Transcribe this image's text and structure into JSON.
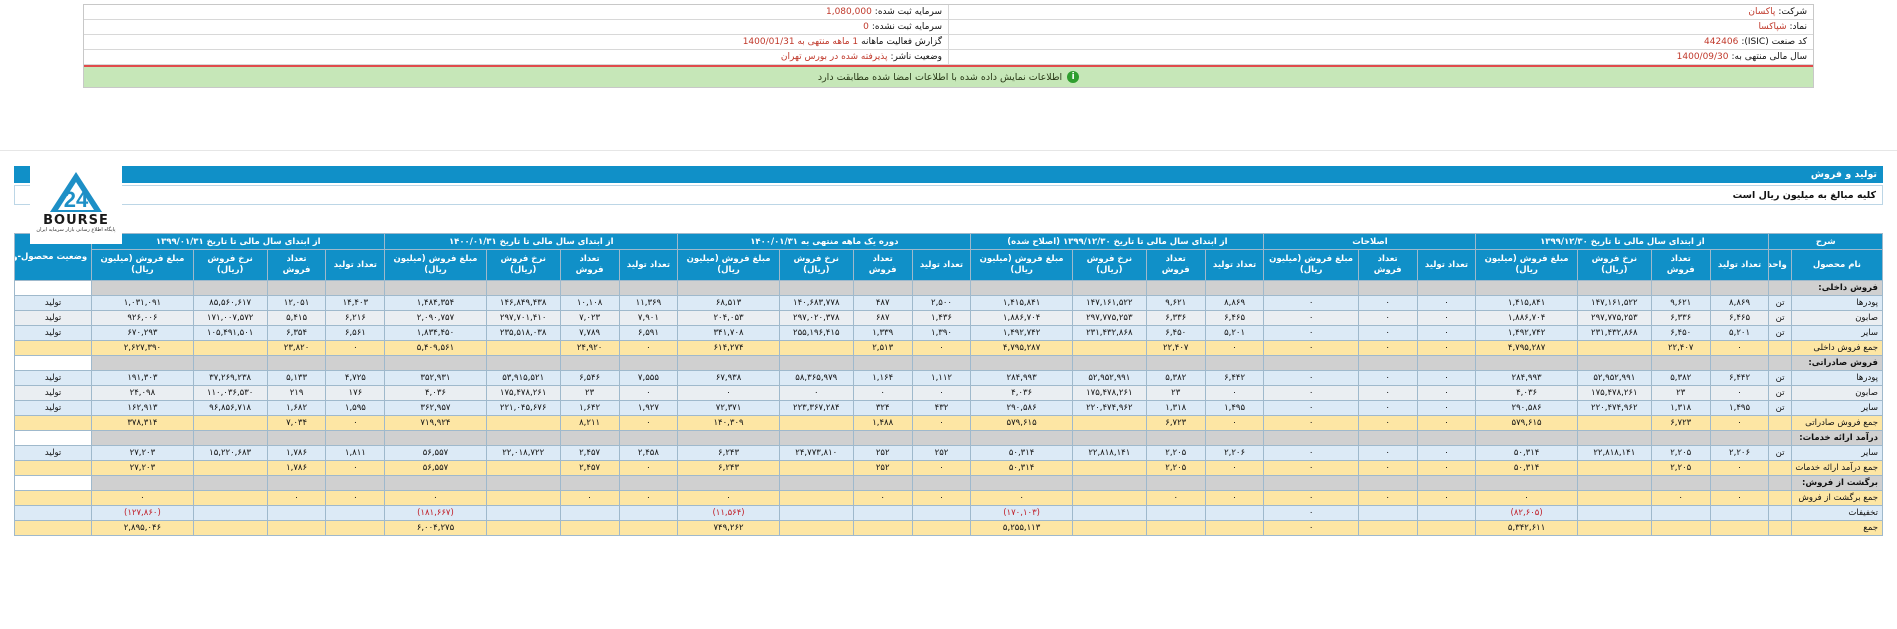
{
  "header": {
    "company_label": "شرکت:",
    "company_value": "پاکسان",
    "symbol_label": "نماد:",
    "symbol_value": "شپاکسا",
    "isic_label": "کد صنعت (ISIC):",
    "isic_value": "442406",
    "fiscal_label": "سال مالی منتهی به:",
    "fiscal_value": "1400/09/30",
    "reg_capital_label": "سرمایه ثبت شده:",
    "reg_capital_value": "1,080,000",
    "unreg_capital_label": "سرمایه ثبت نشده:",
    "unreg_capital_value": "0",
    "report_label": "گزارش فعالیت ماهانه",
    "report_value": "1 ماهه منتهی به 1400/01/31",
    "status_label": "وضعیت ناشر:",
    "status_value": "پذیرفته شده در بورس تهران",
    "notice": "اطلاعات نمایش داده شده با اطلاعات امضا شده مطابقت دارد",
    "notice_icon": "i"
  },
  "section": {
    "title": "تولید و فروش",
    "subtitle": "کلیه مبالغ به میلیون ریال است"
  },
  "logo": {
    "text": "BOURSE",
    "sub": "پایگاه اطلاع رسانی بازار سرمایه ایران"
  },
  "table": {
    "side_header": "وضعیت محصول-واحد",
    "col_desc": "شرح",
    "col_product": "نام محصول",
    "col_unit": "واحد",
    "groups": [
      "از ابتدای سال مالی تا تاریخ ۱۳۹۹/۱۲/۳۰",
      "اصلاحات",
      "از ابتدای سال مالی تا تاریخ ۱۳۹۹/۱۲/۳۰ (اصلاح شده)",
      "دوره یک ماهه منتهی به ۱۴۰۰/۰۱/۳۱",
      "از ابتدای سال مالی تا تاریخ ۱۴۰۰/۰۱/۳۱",
      "از ابتدای سال مالی تا تاریخ ۱۳۹۹/۰۱/۳۱"
    ],
    "sub4": [
      "تعداد تولید",
      "تعداد فروش",
      "نرخ فروش (ریال)",
      "مبلغ فروش (میلیون ریال)"
    ],
    "sub3": [
      "تعداد تولید",
      "تعداد فروش",
      "مبلغ فروش (میلیون ریال)"
    ],
    "rows": [
      {
        "kind": "grp",
        "name": "فروش داخلی:",
        "unit": "",
        "cells": [
          "",
          "",
          "",
          "",
          "",
          "",
          "",
          "",
          "",
          "",
          "",
          "",
          "",
          "",
          "",
          "",
          "",
          "",
          "",
          "",
          "",
          "",
          ""
        ],
        "side": ""
      },
      {
        "kind": "r1",
        "name": "پودرها",
        "unit": "تن",
        "cells": [
          "۸,۸۶۹",
          "۹,۶۲۱",
          "۱۴۷,۱۶۱,۵۲۲",
          "۱,۴۱۵,۸۴۱",
          "۰",
          "۰",
          "۰",
          "۸,۸۶۹",
          "۹,۶۲۱",
          "۱۴۷,۱۶۱,۵۲۲",
          "۱,۴۱۵,۸۴۱",
          "۲,۵۰۰",
          "۴۸۷",
          "۱۴۰,۶۸۳,۷۷۸",
          "۶۸,۵۱۳",
          "۱۱,۳۶۹",
          "۱۰,۱۰۸",
          "۱۴۶,۸۴۹,۴۳۸",
          "۱,۴۸۴,۳۵۴",
          "۱۴,۴۰۳",
          "۱۲,۰۵۱",
          "۸۵,۵۶۰,۶۱۷",
          "۱,۰۳۱,۰۹۱"
        ],
        "side": "تولید"
      },
      {
        "kind": "r2",
        "name": "صابون",
        "unit": "تن",
        "cells": [
          "۶,۴۶۵",
          "۶,۳۳۶",
          "۲۹۷,۷۷۵,۲۵۳",
          "۱,۸۸۶,۷۰۴",
          "۰",
          "۰",
          "۰",
          "۶,۴۶۵",
          "۶,۳۳۶",
          "۲۹۷,۷۷۵,۲۵۳",
          "۱,۸۸۶,۷۰۴",
          "۱,۴۳۶",
          "۶۸۷",
          "۲۹۷,۰۲۰,۳۷۸",
          "۲۰۴,۰۵۳",
          "۷,۹۰۱",
          "۷,۰۲۳",
          "۲۹۷,۷۰۱,۴۱۰",
          "۲,۰۹۰,۷۵۷",
          "۶,۲۱۶",
          "۵,۴۱۵",
          "۱۷۱,۰۰۷,۵۷۲",
          "۹۲۶,۰۰۶"
        ],
        "side": "تولید"
      },
      {
        "kind": "r1",
        "name": "سایر",
        "unit": "تن",
        "cells": [
          "۵,۲۰۱",
          "۶,۴۵۰",
          "۲۳۱,۴۳۲,۸۶۸",
          "۱,۴۹۲,۷۴۲",
          "۰",
          "۰",
          "۰",
          "۵,۲۰۱",
          "۶,۴۵۰",
          "۲۳۱,۴۳۲,۸۶۸",
          "۱,۴۹۲,۷۴۲",
          "۱,۳۹۰",
          "۱,۳۳۹",
          "۲۵۵,۱۹۶,۴۱۵",
          "۳۴۱,۷۰۸",
          "۶,۵۹۱",
          "۷,۷۸۹",
          "۲۳۵,۵۱۸,۰۳۸",
          "۱,۸۳۴,۴۵۰",
          "۶,۵۶۱",
          "۶,۳۵۴",
          "۱۰۵,۴۹۱,۵۰۱",
          "۶۷۰,۲۹۳"
        ],
        "side": "تولید"
      },
      {
        "kind": "tot",
        "name": "جمع فروش داخلی",
        "unit": "",
        "cells": [
          "۰",
          "۲۲,۴۰۷",
          "",
          "۴,۷۹۵,۲۸۷",
          "۰",
          "۰",
          "۰",
          "۰",
          "۲۲,۴۰۷",
          "",
          "۴,۷۹۵,۲۸۷",
          "۰",
          "۲,۵۱۳",
          "",
          "۶۱۴,۲۷۴",
          "۰",
          "۲۴,۹۲۰",
          "",
          "۵,۴۰۹,۵۶۱",
          "۰",
          "۲۳,۸۲۰",
          "",
          "۲,۶۲۷,۳۹۰"
        ],
        "side": ""
      },
      {
        "kind": "grp",
        "name": "فروش صادراتی:",
        "unit": "",
        "cells": [
          "",
          "",
          "",
          "",
          "",
          "",
          "",
          "",
          "",
          "",
          "",
          "",
          "",
          "",
          "",
          "",
          "",
          "",
          "",
          "",
          "",
          "",
          ""
        ],
        "side": ""
      },
      {
        "kind": "r1",
        "name": "پودرها",
        "unit": "تن",
        "cells": [
          "۶,۴۴۲",
          "۵,۳۸۲",
          "۵۲,۹۵۲,۹۹۱",
          "۲۸۴,۹۹۳",
          "۰",
          "۰",
          "۰",
          "۶,۴۴۲",
          "۵,۳۸۲",
          "۵۲,۹۵۲,۹۹۱",
          "۲۸۴,۹۹۳",
          "۱,۱۱۲",
          "۱,۱۶۴",
          "۵۸,۳۶۵,۹۷۹",
          "۶۷,۹۳۸",
          "۷,۵۵۵",
          "۶,۵۴۶",
          "۵۳,۹۱۵,۵۲۱",
          "۳۵۲,۹۳۱",
          "۴,۷۲۵",
          "۵,۱۳۳",
          "۳۷,۲۶۹,۲۳۸",
          "۱۹۱,۳۰۳"
        ],
        "side": "تولید"
      },
      {
        "kind": "r2",
        "name": "صابون",
        "unit": "تن",
        "cells": [
          "۰",
          "۲۳",
          "۱۷۵,۴۷۸,۲۶۱",
          "۴,۰۳۶",
          "۰",
          "۰",
          "۰",
          "۰",
          "۲۳",
          "۱۷۵,۴۷۸,۲۶۱",
          "۴,۰۳۶",
          "۰",
          "۰",
          "۰",
          "۰",
          "۰",
          "۲۳",
          "۱۷۵,۴۷۸,۲۶۱",
          "۴,۰۳۶",
          "۱۷۶",
          "۲۱۹",
          "۱۱۰,۰۳۶,۵۳۰",
          "۲۴,۰۹۸"
        ],
        "side": "تولید"
      },
      {
        "kind": "r1",
        "name": "سایر",
        "unit": "تن",
        "cells": [
          "۱,۴۹۵",
          "۱,۳۱۸",
          "۲۲۰,۴۷۴,۹۶۲",
          "۲۹۰,۵۸۶",
          "۰",
          "۰",
          "۰",
          "۱,۴۹۵",
          "۱,۳۱۸",
          "۲۲۰,۴۷۴,۹۶۲",
          "۲۹۰,۵۸۶",
          "۴۳۲",
          "۳۲۴",
          "۲۲۳,۳۶۷,۲۸۴",
          "۷۲,۳۷۱",
          "۱,۹۲۷",
          "۱,۶۴۲",
          "۲۲۱,۰۴۵,۶۷۶",
          "۳۶۲,۹۵۷",
          "۱,۵۹۵",
          "۱,۶۸۲",
          "۹۶,۸۵۶,۷۱۸",
          "۱۶۲,۹۱۳"
        ],
        "side": "تولید"
      },
      {
        "kind": "tot",
        "name": "جمع فروش صادراتی",
        "unit": "",
        "cells": [
          "۰",
          "۶,۷۲۳",
          "",
          "۵۷۹,۶۱۵",
          "۰",
          "۰",
          "۰",
          "۰",
          "۶,۷۲۳",
          "",
          "۵۷۹,۶۱۵",
          "۰",
          "۱,۴۸۸",
          "",
          "۱۴۰,۳۰۹",
          "۰",
          "۸,۲۱۱",
          "",
          "۷۱۹,۹۲۴",
          "۰",
          "۷,۰۳۴",
          "",
          "۳۷۸,۳۱۴"
        ],
        "side": ""
      },
      {
        "kind": "grp",
        "name": "درآمد ارائه خدمات:",
        "unit": "",
        "cells": [
          "",
          "",
          "",
          "",
          "",
          "",
          "",
          "",
          "",
          "",
          "",
          "",
          "",
          "",
          "",
          "",
          "",
          "",
          "",
          "",
          "",
          "",
          ""
        ],
        "side": ""
      },
      {
        "kind": "r1",
        "name": "سایر",
        "unit": "تن",
        "cells": [
          "۲,۲۰۶",
          "۲,۲۰۵",
          "۲۲,۸۱۸,۱۴۱",
          "۵۰,۳۱۴",
          "۰",
          "۰",
          "۰",
          "۲,۲۰۶",
          "۲,۲۰۵",
          "۲۲,۸۱۸,۱۴۱",
          "۵۰,۳۱۴",
          "۲۵۲",
          "۲۵۲",
          "۲۴,۷۷۳,۸۱۰",
          "۶,۲۴۳",
          "۲,۴۵۸",
          "۲,۴۵۷",
          "۲۲,۰۱۸,۷۲۲",
          "۵۶,۵۵۷",
          "۱,۸۱۱",
          "۱,۷۸۶",
          "۱۵,۲۲۰,۶۸۳",
          "۲۷,۲۰۳"
        ],
        "side": "تولید"
      },
      {
        "kind": "tot",
        "name": "جمع درآمد ارائه خدمات",
        "unit": "",
        "cells": [
          "۰",
          "۲,۲۰۵",
          "",
          "۵۰,۳۱۴",
          "۰",
          "۰",
          "۰",
          "۰",
          "۲,۲۰۵",
          "",
          "۵۰,۳۱۴",
          "۰",
          "۲۵۲",
          "",
          "۶,۲۴۳",
          "۰",
          "۲,۴۵۷",
          "",
          "۵۶,۵۵۷",
          "۰",
          "۱,۷۸۶",
          "",
          "۲۷,۲۰۳"
        ],
        "side": ""
      },
      {
        "kind": "grp",
        "name": "برگشت از فروش:",
        "unit": "",
        "cells": [
          "",
          "",
          "",
          "",
          "",
          "",
          "",
          "",
          "",
          "",
          "",
          "",
          "",
          "",
          "",
          "",
          "",
          "",
          "",
          "",
          "",
          "",
          ""
        ],
        "side": ""
      },
      {
        "kind": "tot",
        "name": "جمع برگشت از فروش",
        "unit": "",
        "cells": [
          "۰",
          "۰",
          "",
          "۰",
          "۰",
          "۰",
          "۰",
          "۰",
          "۰",
          "",
          "۰",
          "۰",
          "۰",
          "",
          "۰",
          "۰",
          "۰",
          "",
          "۰",
          "۰",
          "۰",
          "",
          "۰"
        ],
        "side": ""
      },
      {
        "kind": "r1",
        "name": "تخفیفات",
        "unit": "",
        "cells": [
          "",
          "",
          "",
          "(۸۲,۶۰۵)",
          "",
          "",
          "۰",
          "",
          "",
          "",
          "(۱۷۰,۱۰۳)",
          "",
          "",
          "",
          "(۱۱,۵۶۴)",
          "",
          "",
          "",
          "(۱۸۱,۶۶۷)",
          "",
          "",
          "",
          "(۱۲۷,۸۶۰)"
        ],
        "side": ""
      },
      {
        "kind": "tot",
        "name": "جمع",
        "unit": "",
        "cells": [
          "",
          "",
          "",
          "۵,۳۴۲,۶۱۱",
          "",
          "",
          "۰",
          "",
          "",
          "",
          "۵,۲۵۵,۱۱۳",
          "",
          "",
          "",
          "۷۴۹,۲۶۲",
          "",
          "",
          "",
          "۶,۰۰۴,۲۷۵",
          "",
          "",
          "",
          "۲,۸۹۵,۰۴۶"
        ],
        "side": ""
      }
    ]
  }
}
